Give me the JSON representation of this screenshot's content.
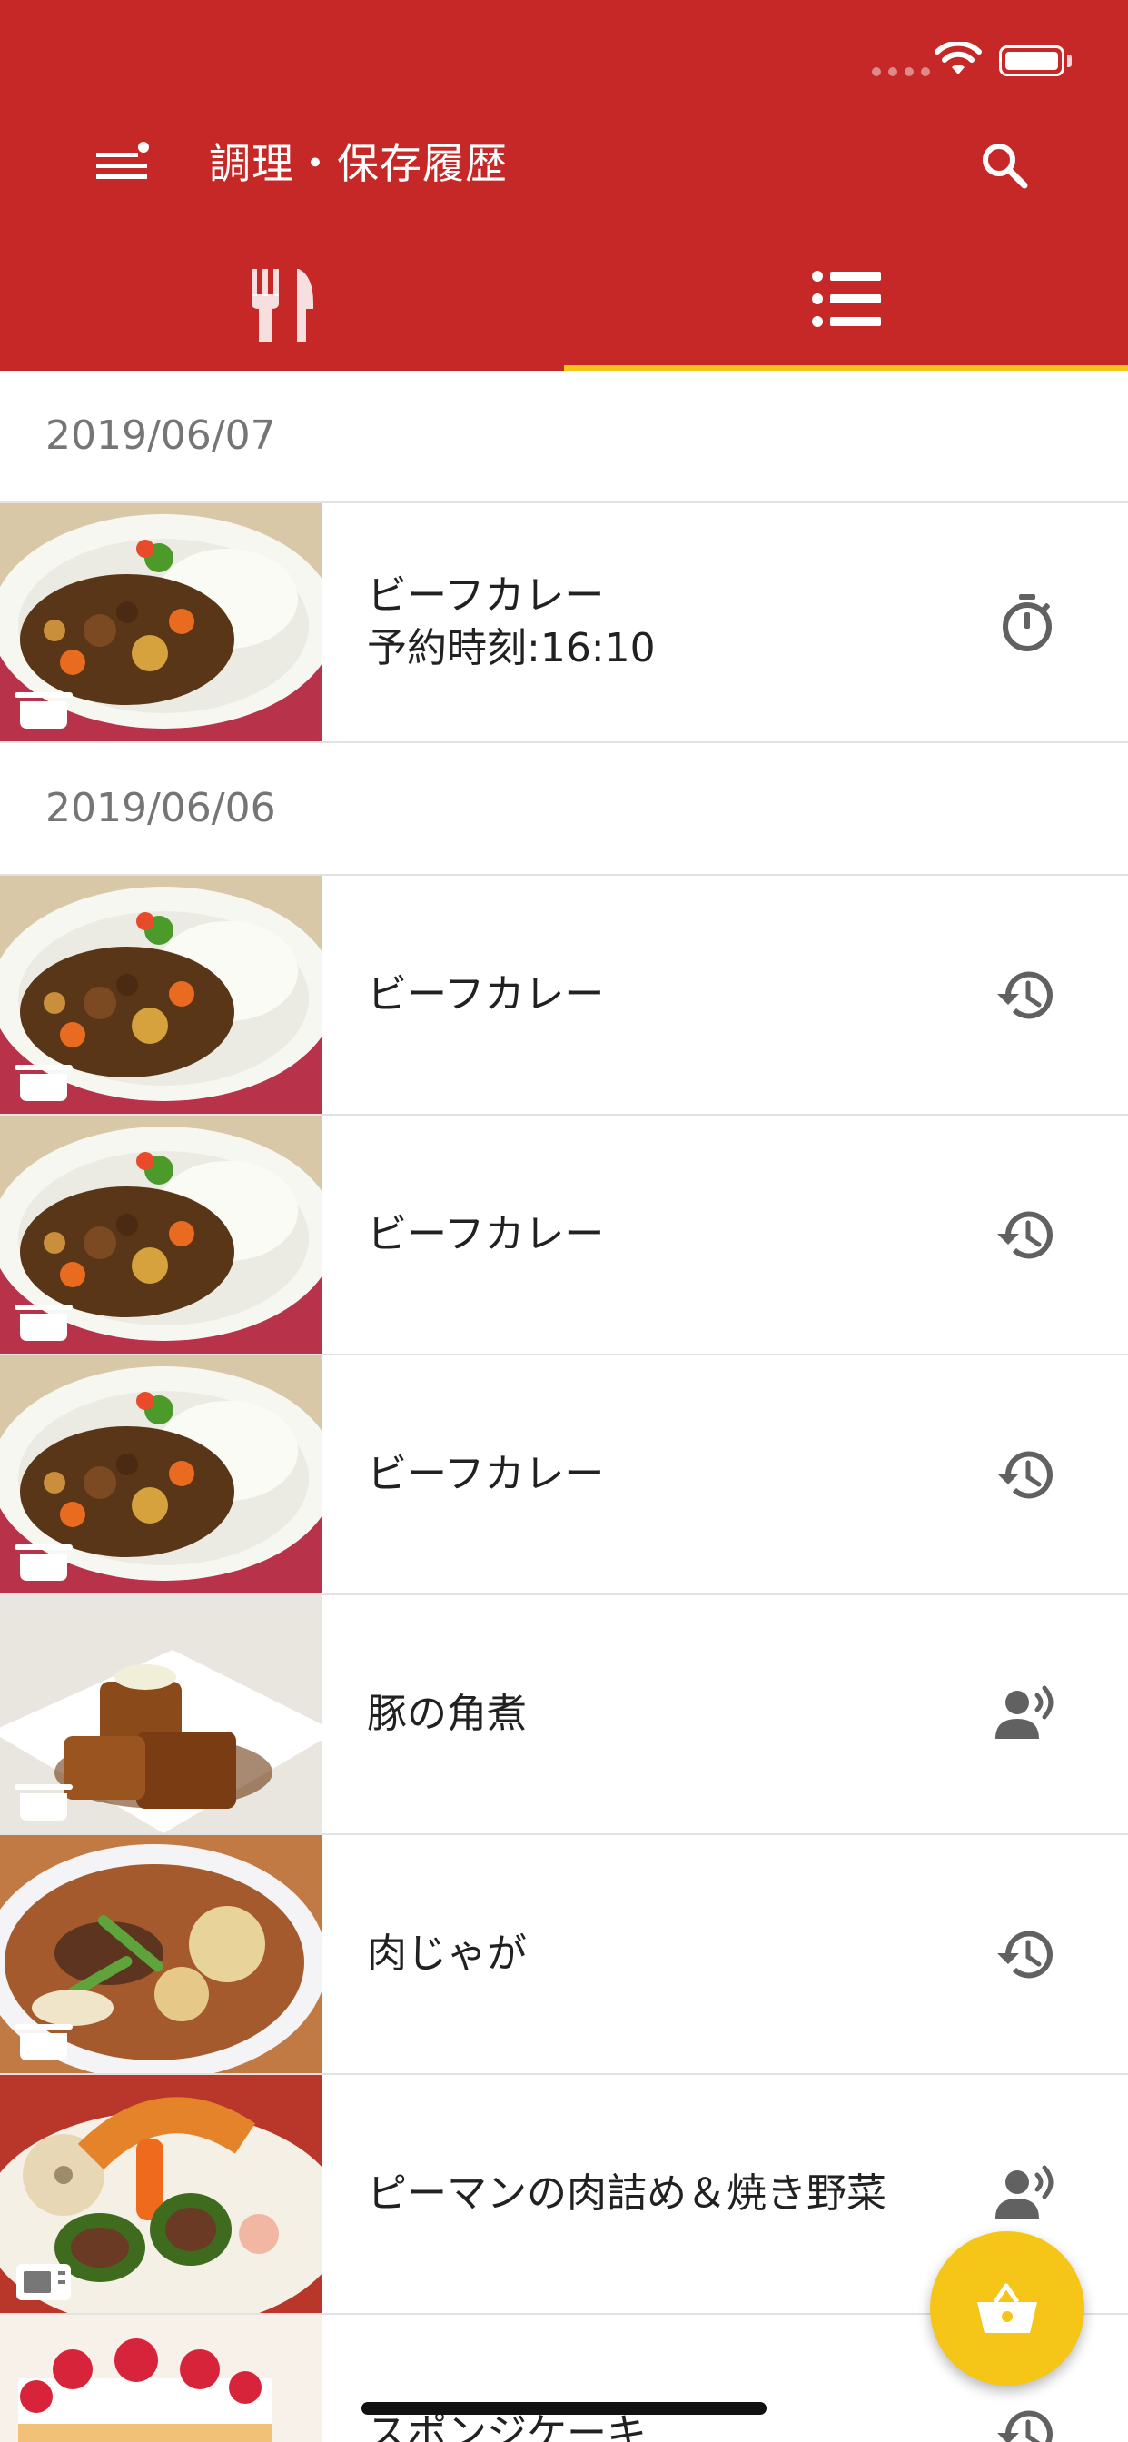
{
  "theme": {
    "brand": "#c62828",
    "accent": "#f5c518",
    "text": "#212121",
    "muted": "#757575",
    "icon_color": "#616161"
  },
  "status_bar": {
    "icons": [
      "signal-icon",
      "wifi-icon",
      "battery-icon"
    ]
  },
  "header": {
    "title": "調理・保存履歴",
    "menu_icon": "menu-icon",
    "search_icon": "search-icon"
  },
  "tabs": [
    {
      "icon": "fork-knife-icon",
      "selected": false
    },
    {
      "icon": "list-icon",
      "selected": true
    }
  ],
  "groups": [
    {
      "date": "2019/06/07",
      "items": [
        {
          "title": "ビーフカレー",
          "subtitle": "予約時刻:16:10",
          "image": "beef-curry",
          "appliance": "pot-icon",
          "action_icon": "timer-icon"
        }
      ]
    },
    {
      "date": "2019/06/06",
      "items": [
        {
          "title": "ビーフカレー",
          "image": "beef-curry",
          "appliance": "pot-icon",
          "action_icon": "history-icon"
        },
        {
          "title": "ビーフカレー",
          "image": "beef-curry",
          "appliance": "pot-icon",
          "action_icon": "history-icon"
        },
        {
          "title": "ビーフカレー",
          "image": "beef-curry",
          "appliance": "pot-icon",
          "action_icon": "history-icon"
        },
        {
          "title": "豚の角煮",
          "image": "pork-kakuni",
          "appliance": "pot-icon",
          "action_icon": "voice-icon"
        },
        {
          "title": "肉じゃが",
          "image": "nikujaga",
          "appliance": "pot-icon",
          "action_icon": "history-icon"
        },
        {
          "title": "ピーマンの肉詰め＆焼き野菜",
          "image": "stuffed-peppers",
          "appliance": "microwave-icon",
          "action_icon": "voice-icon"
        },
        {
          "title": "スポンジケーキ",
          "image": "sponge-cake",
          "appliance": "",
          "action_icon": "history-icon"
        }
      ]
    }
  ],
  "fab": {
    "icon": "basket-icon"
  }
}
